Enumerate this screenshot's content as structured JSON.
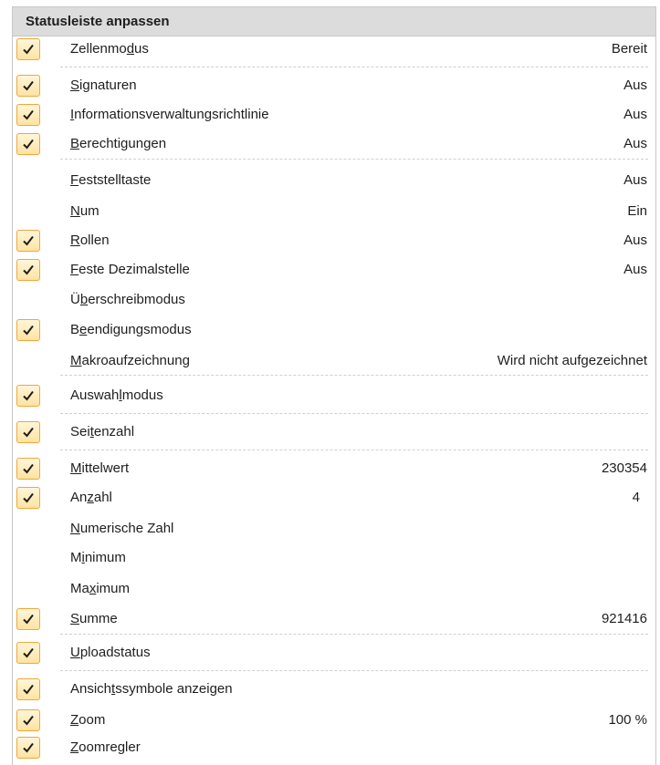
{
  "menu": {
    "title": "Statusleiste anpassen",
    "accent_color": "#f0a73a",
    "items": [
      {
        "id": "zellenmodus",
        "checked": true,
        "pre": "Zellenmo",
        "acc": "d",
        "post": "us",
        "value": "Bereit"
      },
      {
        "id": "signaturen",
        "checked": true,
        "pre": "",
        "acc": "S",
        "post": "ignaturen",
        "value": "Aus"
      },
      {
        "id": "informationsverwaltungsrichtlinie",
        "checked": true,
        "pre": "",
        "acc": "I",
        "post": "nformationsverwaltungsrichtlinie",
        "value": "Aus"
      },
      {
        "id": "berechtigungen",
        "checked": true,
        "pre": "",
        "acc": "B",
        "post": "erechtigungen",
        "value": "Aus"
      },
      {
        "id": "feststelltaste",
        "checked": false,
        "pre": "",
        "acc": "F",
        "post": "eststelltaste",
        "value": "Aus"
      },
      {
        "id": "num",
        "checked": false,
        "pre": "",
        "acc": "N",
        "post": "um",
        "value": "Ein"
      },
      {
        "id": "rollen",
        "checked": true,
        "pre": "",
        "acc": "R",
        "post": "ollen",
        "value": "Aus"
      },
      {
        "id": "feste-dezimalstelle",
        "checked": true,
        "pre": "",
        "acc": "F",
        "post": "este Dezimalstelle",
        "value": "Aus"
      },
      {
        "id": "ueberschreibmodus",
        "checked": false,
        "pre": "Ü",
        "acc": "b",
        "post": "erschreibmodus",
        "value": ""
      },
      {
        "id": "beendigungsmodus",
        "checked": true,
        "pre": "B",
        "acc": "e",
        "post": "endigungsmodus",
        "value": ""
      },
      {
        "id": "makroaufzeichnung",
        "checked": false,
        "pre": "",
        "acc": "M",
        "post": "akroaufzeichnung",
        "value": "Wird nicht aufgezeichnet"
      },
      {
        "id": "auswahlmodus",
        "checked": true,
        "pre": "Auswah",
        "acc": "l",
        "post": "modus",
        "value": ""
      },
      {
        "id": "seitenzahl",
        "checked": true,
        "pre": "Sei",
        "acc": "t",
        "post": "enzahl",
        "value": ""
      },
      {
        "id": "mittelwert",
        "checked": true,
        "pre": "",
        "acc": "M",
        "post": "ittelwert",
        "value": "230354"
      },
      {
        "id": "anzahl",
        "checked": true,
        "pre": "An",
        "acc": "z",
        "post": "ahl",
        "value": "4"
      },
      {
        "id": "numerische-zahl",
        "checked": false,
        "pre": "",
        "acc": "N",
        "post": "umerische Zahl",
        "value": ""
      },
      {
        "id": "minimum",
        "checked": false,
        "pre": "M",
        "acc": "i",
        "post": "nimum",
        "value": ""
      },
      {
        "id": "maximum",
        "checked": false,
        "pre": "Ma",
        "acc": "x",
        "post": "imum",
        "value": ""
      },
      {
        "id": "summe",
        "checked": true,
        "pre": "",
        "acc": "S",
        "post": "umme",
        "value": "921416"
      },
      {
        "id": "uploadstatus",
        "checked": true,
        "pre": "",
        "acc": "U",
        "post": "ploadstatus",
        "value": ""
      },
      {
        "id": "ansichtssymbole-anzeigen",
        "checked": true,
        "pre": "Ansich",
        "acc": "t",
        "post": "ssymbole anzeigen",
        "value": ""
      },
      {
        "id": "zoom",
        "checked": true,
        "pre": "",
        "acc": "Z",
        "post": "oom",
        "value": "100 %"
      },
      {
        "id": "zoomregler",
        "checked": true,
        "pre": "",
        "acc": "Z",
        "post": "oomregler",
        "value": ""
      }
    ]
  }
}
